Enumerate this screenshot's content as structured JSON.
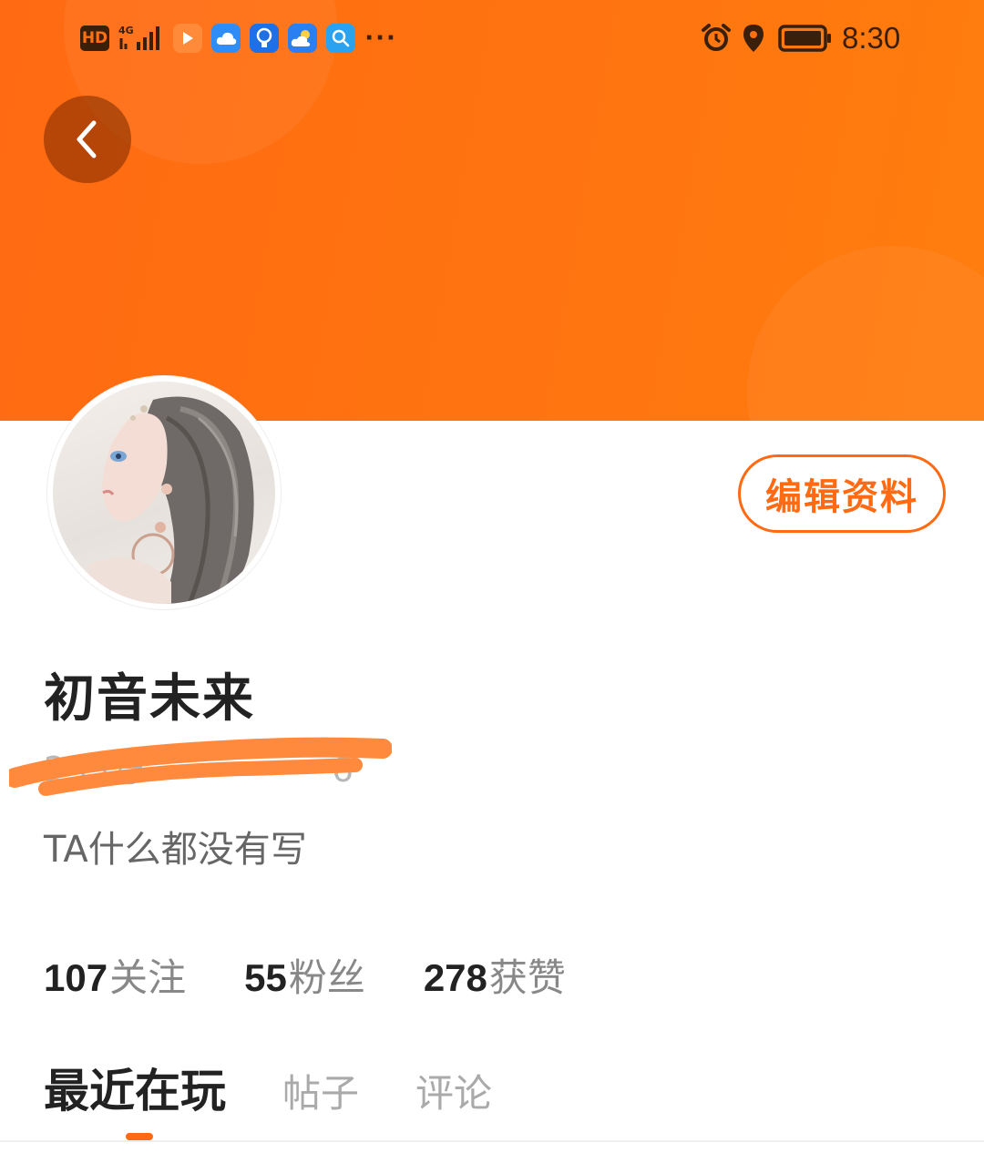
{
  "status_bar": {
    "hd_badge": "HD",
    "network": "4G",
    "time": "8:30",
    "more_glyph": "···",
    "icons": [
      "hd-icon",
      "signal-icon",
      "video-app-icon",
      "cloud-app-icon",
      "bulb-app-icon",
      "weather-app-icon",
      "search-app-icon",
      "more-icon",
      "alarm-icon",
      "location-icon",
      "battery-icon"
    ]
  },
  "colors": {
    "accent": "#ff6a12",
    "header_gradient_start": "#ff6a12",
    "header_gradient_end": "#ff7d0e",
    "text_primary": "#222222",
    "text_secondary": "#888888"
  },
  "header": {
    "back_icon": "chevron-left-icon"
  },
  "profile": {
    "username": "初音未来",
    "uid": "233号 ················6",
    "bio": "TA什么都没有写",
    "edit_button": "编辑资料"
  },
  "stats": [
    {
      "value": "107",
      "label": "关注"
    },
    {
      "value": "55",
      "label": "粉丝"
    },
    {
      "value": "278",
      "label": "获赞"
    }
  ],
  "tabs": [
    {
      "label": "最近在玩",
      "active": true
    },
    {
      "label": "帖子",
      "active": false
    },
    {
      "label": "评论",
      "active": false
    }
  ]
}
